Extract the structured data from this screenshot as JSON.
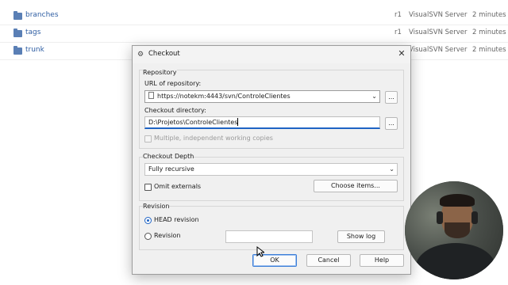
{
  "repo_browser": {
    "rows": [
      {
        "name": "branches",
        "rev": "r1",
        "author": "VisualSVN Server",
        "date": "2 minutes a"
      },
      {
        "name": "tags",
        "rev": "r1",
        "author": "VisualSVN Server",
        "date": "2 minutes a"
      },
      {
        "name": "trunk",
        "rev": "r1",
        "author": "VisualSVN Server",
        "date": "2 minutes a"
      }
    ]
  },
  "dialog": {
    "title": "Checkout",
    "close_glyph": "✕",
    "repository": {
      "group_label": "Repository",
      "url_label": "URL of repository:",
      "url_value": "https://notekm:4443/svn/ControleClientes",
      "browse_label": "...",
      "checkout_dir_label": "Checkout directory:",
      "checkout_dir_value": "D:\\Projetos\\ControleClientes",
      "dir_browse_label": "...",
      "multiple_copies_label": "Multiple, independent working copies"
    },
    "depth": {
      "group_label": "Checkout Depth",
      "selected": "Fully recursive",
      "omit_externals_label": "Omit externals",
      "choose_items_label": "Choose items..."
    },
    "revision": {
      "group_label": "Revision",
      "head_label": "HEAD revision",
      "revision_label": "Revision",
      "revision_value": "",
      "show_log_label": "Show log"
    },
    "buttons": {
      "ok": "OK",
      "cancel": "Cancel",
      "help": "Help"
    }
  }
}
